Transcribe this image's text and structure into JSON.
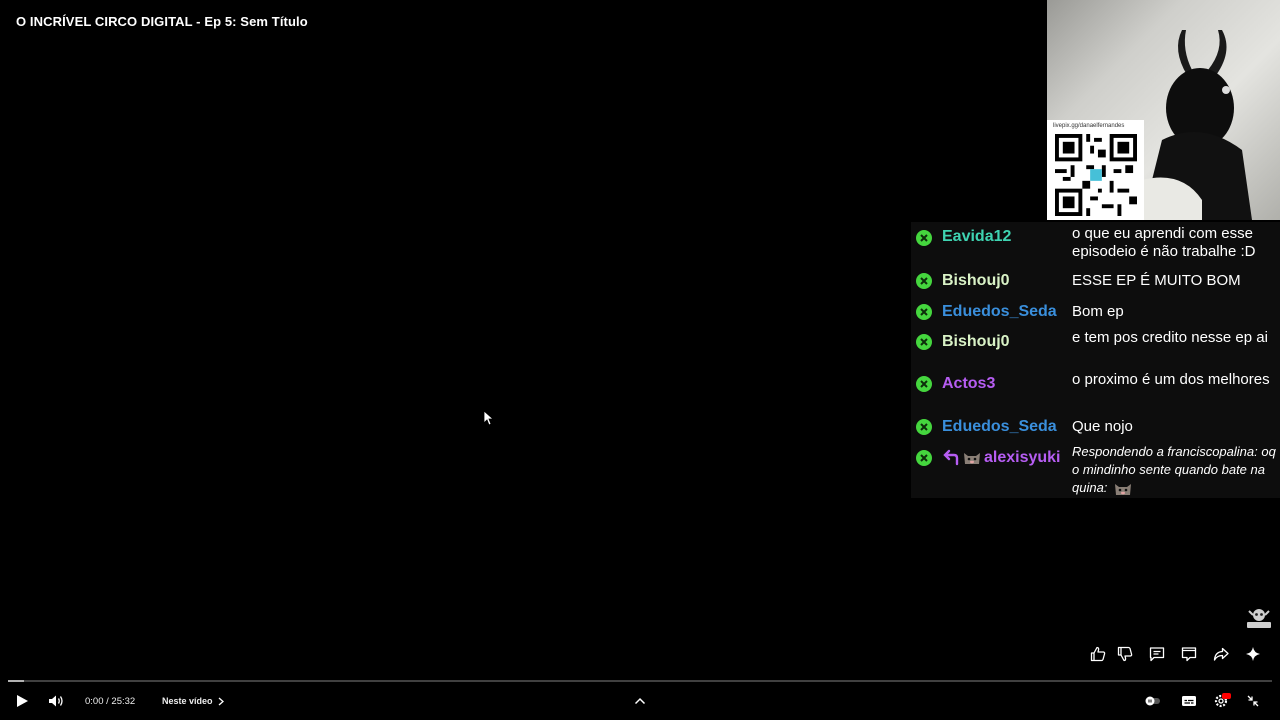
{
  "video": {
    "title": "O INCRÍVEL CIRCO DIGITAL - Ep 5: Sem Título"
  },
  "overlay": {
    "qr_url": "livepix.gg/danaelfernandes"
  },
  "chat": {
    "messages": [
      {
        "user": "Eavida12",
        "user_color": "#3fd4b2",
        "text": "o que eu aprendi com esse episodeio é não trabalhe :D"
      },
      {
        "user": "Bishouj0",
        "user_color": "#d9f2c6",
        "text": "ESSE EP É MUITO BOM"
      },
      {
        "user": "Eduedos_Seda",
        "user_color": "#3a8fdc",
        "text": "Bom ep"
      },
      {
        "user": "Bishouj0",
        "user_color": "#d9f2c6",
        "text": "e tem pos credito nesse ep ai"
      },
      {
        "user": "Actos3",
        "user_color": "#b65df2",
        "text": "o proximo é um dos melhores"
      },
      {
        "user": "Eduedos_Seda",
        "user_color": "#3a8fdc",
        "text": "Que nojo"
      },
      {
        "user": "alexisyuki",
        "user_color": "#b65df2",
        "text": "Respondendo a franciscopalina: oq o mindinho sente quando bate na quina:"
      }
    ]
  },
  "actions": {
    "like": "thumbs-up-icon",
    "dislike": "thumbs-down-icon",
    "comments": "comment-icon",
    "chat": "chat-icon",
    "share": "share-icon",
    "ask": "sparkle-icon"
  },
  "player": {
    "time": "0:00 / 25:32",
    "chapter": "Neste vídeo",
    "progress": 0,
    "accent": "#ff0000"
  }
}
